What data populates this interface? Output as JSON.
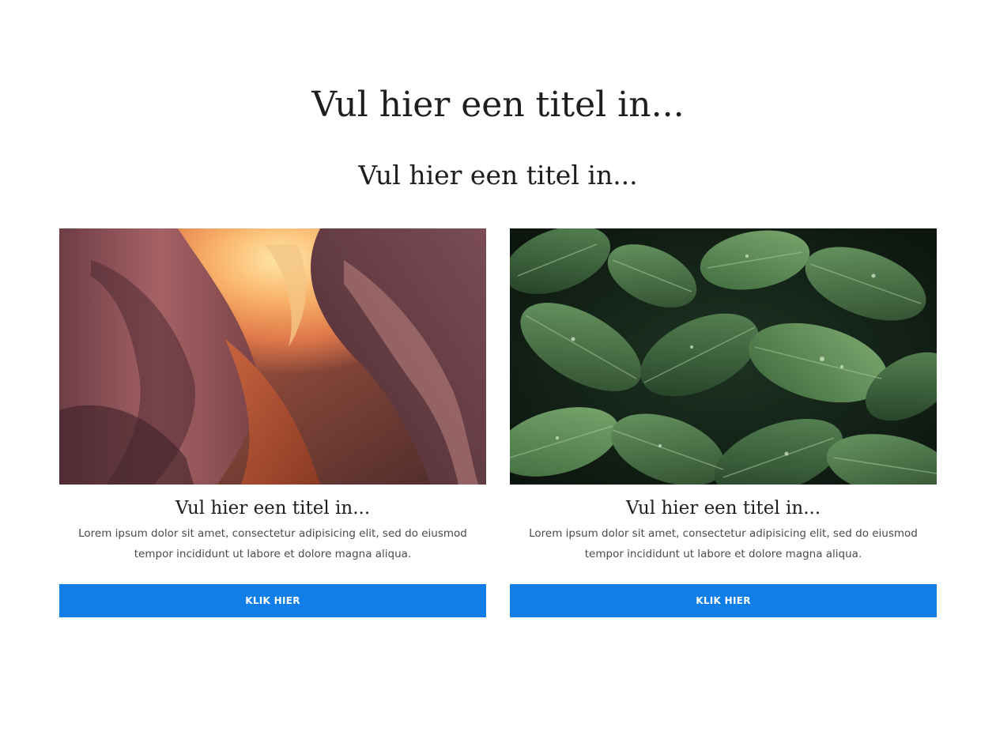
{
  "header": {
    "title": "Vul hier een titel in...",
    "subtitle": "Vul hier een titel in..."
  },
  "cards": [
    {
      "image": "canyon-photo",
      "title": "Vul hier een titel in...",
      "text": "Lorem ipsum dolor sit amet, consectetur adipisicing elit, sed do eiusmod tempor incididunt ut labore et dolore magna aliqua.",
      "button_label": "KLIK HIER"
    },
    {
      "image": "leaves-photo",
      "title": "Vul hier een titel in...",
      "text": "Lorem ipsum dolor sit amet, consectetur adipisicing elit, sed do eiusmod tempor incididunt ut labore et dolore magna aliqua.",
      "button_label": "KLIK HIER"
    }
  ],
  "colors": {
    "button": "#0f7ee8",
    "button_text": "#ffffff",
    "heading": "#1e1e1e",
    "body_text": "#4a4a4a"
  }
}
